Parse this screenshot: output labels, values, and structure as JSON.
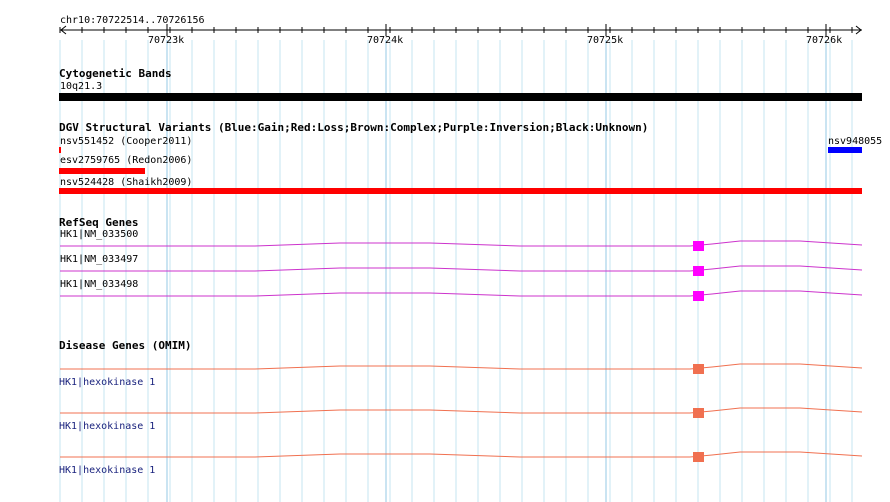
{
  "ruler": {
    "range_label": "chr10:70722514..70726156",
    "ticks": [
      "70723k",
      "70724k",
      "70725k",
      "70726k"
    ]
  },
  "tracks": {
    "cytoband": {
      "title": "Cytogenetic Bands",
      "band_label": "10q21.3",
      "color": "#000000"
    },
    "dgv": {
      "title": "DGV Structural Variants (Blue:Gain;Red:Loss;Brown:Complex;Purple:Inversion;Black:Unknown)",
      "features": [
        {
          "label": "nsv551452 (Cooper2011)",
          "color": "#ff0000"
        },
        {
          "label": "nsv948055",
          "color": "#0000ff"
        },
        {
          "label": "esv2759765 (Redon2006)",
          "color": "#ff0000"
        },
        {
          "label": "nsv524428 (Shaikh2009)",
          "color": "#ff0000"
        }
      ]
    },
    "refseq": {
      "title": "RefSeq Genes",
      "color": "#cc33cc",
      "exon_color": "#ff00ff",
      "genes": [
        {
          "label": "HK1|NM_033500"
        },
        {
          "label": "HK1|NM_033497"
        },
        {
          "label": "HK1|NM_033498"
        }
      ]
    },
    "omim": {
      "title": "Disease Genes (OMIM)",
      "color": "#f07050",
      "exon_color": "#f07050",
      "genes": [
        {
          "label": "HK1|hexokinase 1"
        },
        {
          "label": "HK1|hexokinase 1"
        },
        {
          "label": "HK1|hexokinase 1"
        }
      ]
    }
  },
  "colors": {
    "grid_minor": "#c6e4f2",
    "grid_major": "#96c8e6"
  }
}
